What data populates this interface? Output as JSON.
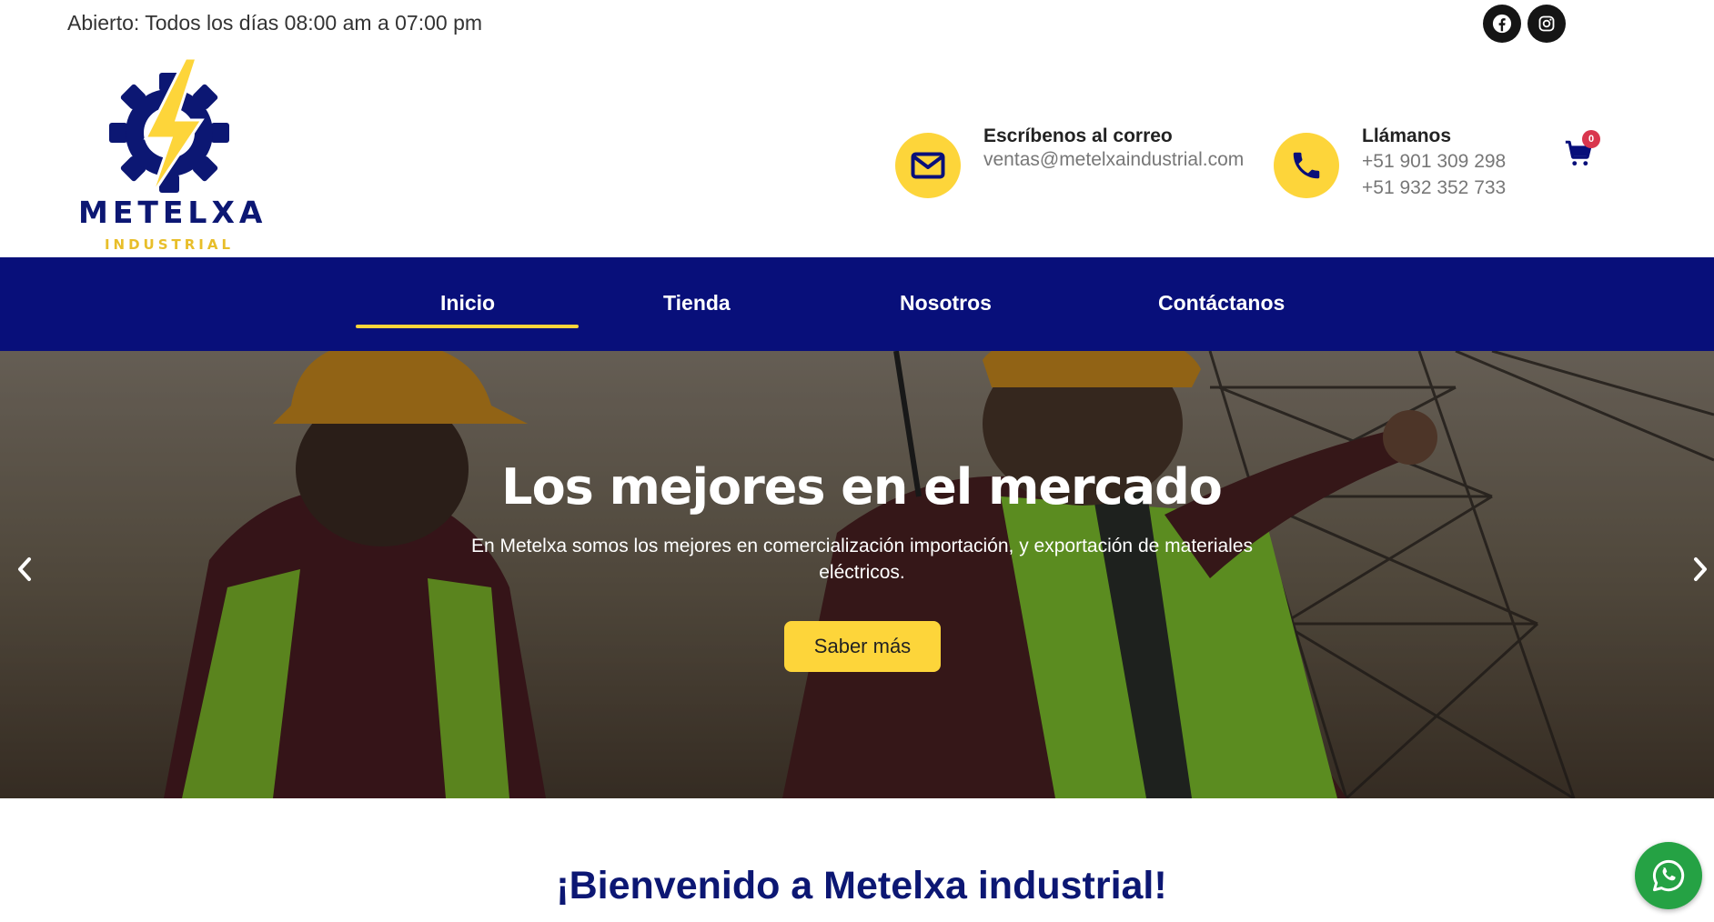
{
  "topbar": {
    "hours": "Abierto: Todos los días 08:00 am a 07:00 pm",
    "social_icons": [
      "facebook-icon",
      "instagram-icon"
    ]
  },
  "brand": {
    "name": "METELXA",
    "tagline": "INDUSTRIAL",
    "primary_color": "#080f7a",
    "accent_color": "#fdd53a"
  },
  "contact": {
    "email_title": "Escríbenos al correo",
    "email": "ventas@metelxaindustrial.com",
    "phone_title": "Llámanos",
    "phone_1": "+51 901 309 298",
    "phone_2": "+51 932 352 733"
  },
  "cart": {
    "count": "0"
  },
  "nav": {
    "items": [
      {
        "label": "Inicio",
        "active": true
      },
      {
        "label": "Tienda",
        "active": false
      },
      {
        "label": "Nosotros",
        "active": false
      },
      {
        "label": "Contáctanos",
        "active": false
      }
    ]
  },
  "hero": {
    "title": "Los mejores en el mercado",
    "subtitle": "En Metelxa somos los mejores en comercialización importación, y exportación de materiales eléctricos.",
    "button_label": "Saber más"
  },
  "welcome": {
    "title": "¡Bienvenido a Metelxa industrial!"
  }
}
